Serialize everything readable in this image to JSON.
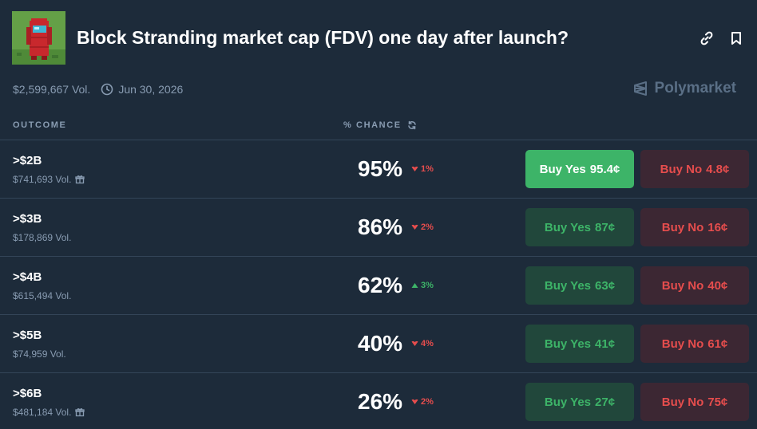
{
  "header": {
    "title": "Block Stranding market cap (FDV) one day after launch?",
    "volume": "$2,599,667 Vol.",
    "end_date": "Jun 30, 2026",
    "brand": "Polymarket"
  },
  "columns": {
    "outcome": "OUTCOME",
    "chance": "% CHANCE"
  },
  "colors": {
    "background": "#1d2b3a",
    "yes_green": "#3db468",
    "no_red": "#e64d4d"
  },
  "rows": [
    {
      "label": ">$2B",
      "volume": "$741,693 Vol.",
      "gift": true,
      "chance": "95%",
      "delta": "1%",
      "direction": "down",
      "yes_label": "Buy Yes",
      "yes_price": "95.4¢",
      "no_label": "Buy No",
      "no_price": "4.8¢",
      "yes_active": true
    },
    {
      "label": ">$3B",
      "volume": "$178,869 Vol.",
      "gift": false,
      "chance": "86%",
      "delta": "2%",
      "direction": "down",
      "yes_label": "Buy Yes",
      "yes_price": "87¢",
      "no_label": "Buy No",
      "no_price": "16¢",
      "yes_active": false
    },
    {
      "label": ">$4B",
      "volume": "$615,494 Vol.",
      "gift": false,
      "chance": "62%",
      "delta": "3%",
      "direction": "up",
      "yes_label": "Buy Yes",
      "yes_price": "63¢",
      "no_label": "Buy No",
      "no_price": "40¢",
      "yes_active": false
    },
    {
      "label": ">$5B",
      "volume": "$74,959 Vol.",
      "gift": false,
      "chance": "40%",
      "delta": "4%",
      "direction": "down",
      "yes_label": "Buy Yes",
      "yes_price": "41¢",
      "no_label": "Buy No",
      "no_price": "61¢",
      "yes_active": false
    },
    {
      "label": ">$6B",
      "volume": "$481,184 Vol.",
      "gift": true,
      "chance": "26%",
      "delta": "2%",
      "direction": "down",
      "yes_label": "Buy Yes",
      "yes_price": "27¢",
      "no_label": "Buy No",
      "no_price": "75¢",
      "yes_active": false
    }
  ]
}
